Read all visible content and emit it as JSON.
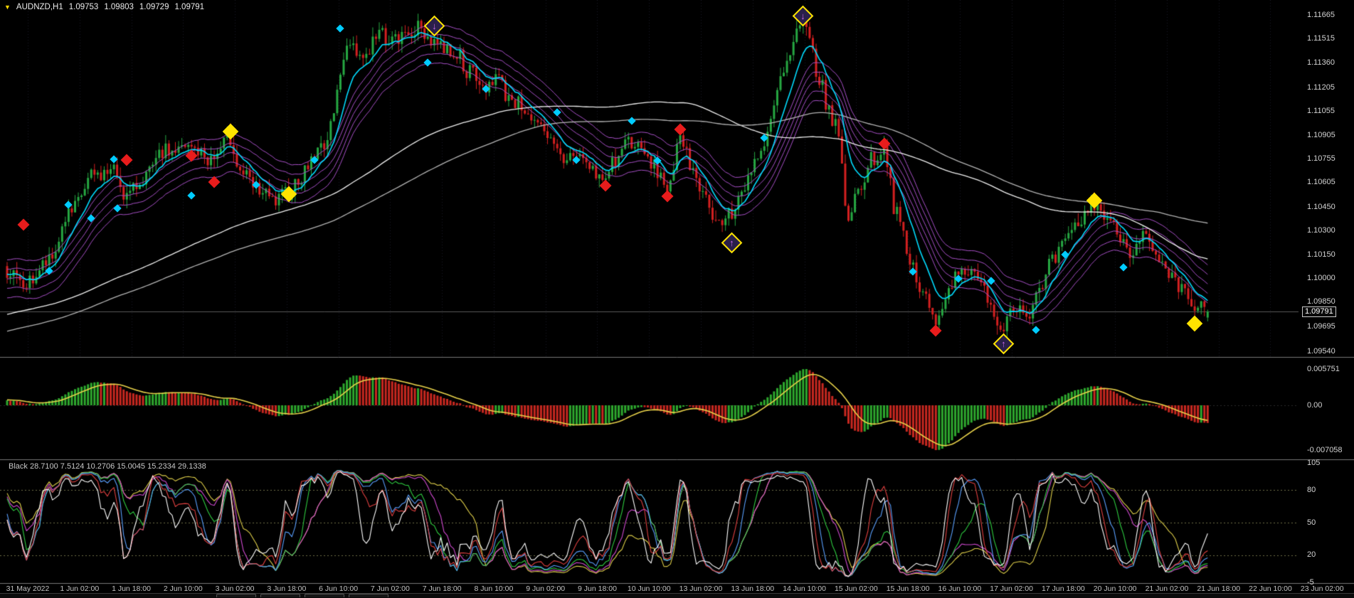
{
  "header": {
    "symbol": "AUDNZD,H1",
    "open": "1.09753",
    "high": "1.09803",
    "low": "1.09729",
    "close": "1.09791"
  },
  "icons": {
    "symbol_dropdown": "▼",
    "arrow_up": "↑",
    "arrow_down": "↓"
  },
  "colors": {
    "background": "#000000",
    "bull": "#26a842",
    "bear": "#d42020",
    "fast_ma": "#00dcff",
    "band": "#a850c8",
    "slow_ma_1": "#f0f0f0",
    "slow_ma_2": "#b4b4b4",
    "price_line": "#5a5a5a",
    "divider": "#787878",
    "grid": "#1b1b26",
    "level_dotted": "#6e6e46",
    "marker_cyan": "#00ccff",
    "marker_red": "#e81c1c",
    "marker_yellow": "#ffe400",
    "marker_arrow_fill": "#2a1f4a",
    "marker_arrow_glyph": "#c668e8"
  },
  "price_scale": {
    "current": "1.09791",
    "labels": [
      "1.11665",
      "1.11515",
      "1.11360",
      "1.11205",
      "1.11055",
      "1.10905",
      "1.10755",
      "1.10605",
      "1.10450",
      "1.10300",
      "1.10150",
      "1.10000",
      "1.09850",
      "1.09695",
      "1.09540"
    ],
    "values": [
      1.11665,
      1.11515,
      1.1136,
      1.11205,
      1.11055,
      1.10905,
      1.10755,
      1.10605,
      1.1045,
      1.103,
      1.1015,
      1.1,
      1.0985,
      1.09695,
      1.0954
    ]
  },
  "stoch_scale": {
    "labels": [
      "105",
      "80",
      "50",
      "20",
      "-5"
    ],
    "values": [
      105,
      80,
      50,
      20,
      -5
    ]
  },
  "time_axis": {
    "labels": [
      "31 May 2022",
      "1 Jun 02:00",
      "1 Jun 18:00",
      "2 Jun 10:00",
      "3 Jun 02:00",
      "3 Jun 18:00",
      "6 Jun 10:00",
      "7 Jun 02:00",
      "7 Jun 18:00",
      "8 Jun 10:00",
      "9 Jun 02:00",
      "9 Jun 18:00",
      "10 Jun 10:00",
      "13 Jun 02:00",
      "13 Jun 18:00",
      "14 Jun 10:00",
      "15 Jun 02:00",
      "15 Jun 18:00",
      "16 Jun 10:00",
      "17 Jun 02:00",
      "17 Jun 18:00",
      "20 Jun 10:00",
      "21 Jun 02:00",
      "21 Jun 18:00",
      "22 Jun 10:00",
      "23 Jun 02:00"
    ],
    "bars_per_label": 16
  },
  "indicator_label": {
    "name": "Black",
    "values": [
      "28.7100",
      "7.5124",
      "10.2706",
      "15.0045",
      "15.2334",
      "29.1338"
    ],
    "text": "Black 28.7100 7.5124 10.2706 15.0045 15.2334 29.1338"
  },
  "bottom_bar": {
    "tab_count": 4
  },
  "chart_data": [
    {
      "type": "candlestick",
      "title": "AUDNZD H1 candles with fast EMA, purple EMA band, two slow MAs and diamond signals",
      "n_bars": 372,
      "ylim": [
        1.0954,
        1.11665
      ],
      "last_bar": {
        "open": 1.09753,
        "high": 1.09803,
        "low": 1.09729,
        "close": 1.09791
      },
      "price_anchors": [
        [
          0,
          1.1005
        ],
        [
          5,
          1.0995
        ],
        [
          13,
          1.101
        ],
        [
          19,
          1.104
        ],
        [
          27,
          1.1065
        ],
        [
          33,
          1.1068
        ],
        [
          37,
          1.1052
        ],
        [
          43,
          1.1065
        ],
        [
          49,
          1.108
        ],
        [
          57,
          1.1082
        ],
        [
          63,
          1.1075
        ],
        [
          69,
          1.1088
        ],
        [
          72,
          1.1068
        ],
        [
          77,
          1.1056
        ],
        [
          83,
          1.1048
        ],
        [
          87,
          1.1055
        ],
        [
          91,
          1.1065
        ],
        [
          95,
          1.1078
        ],
        [
          99,
          1.1088
        ],
        [
          103,
          1.113
        ],
        [
          106,
          1.115
        ],
        [
          110,
          1.114
        ],
        [
          115,
          1.1155
        ],
        [
          120,
          1.115
        ],
        [
          126,
          1.1158
        ],
        [
          131,
          1.1152
        ],
        [
          135,
          1.1146
        ],
        [
          139,
          1.1142
        ],
        [
          143,
          1.113
        ],
        [
          147,
          1.112
        ],
        [
          151,
          1.1128
        ],
        [
          155,
          1.1115
        ],
        [
          160,
          1.1108
        ],
        [
          164,
          1.1095
        ],
        [
          168,
          1.1085
        ],
        [
          172,
          1.1075
        ],
        [
          176,
          1.108
        ],
        [
          180,
          1.107
        ],
        [
          184,
          1.1062
        ],
        [
          188,
          1.1075
        ],
        [
          192,
          1.1088
        ],
        [
          196,
          1.108
        ],
        [
          200,
          1.107
        ],
        [
          204,
          1.1058
        ],
        [
          208,
          1.1085
        ],
        [
          212,
          1.107
        ],
        [
          216,
          1.105
        ],
        [
          220,
          1.1035
        ],
        [
          224,
          1.104
        ],
        [
          228,
          1.106
        ],
        [
          231,
          1.1075
        ],
        [
          234,
          1.108
        ],
        [
          236,
          1.11
        ],
        [
          239,
          1.1125
        ],
        [
          242,
          1.114
        ],
        [
          244,
          1.1155
        ],
        [
          246,
          1.116
        ],
        [
          248,
          1.115
        ],
        [
          251,
          1.1125
        ],
        [
          254,
          1.1105
        ],
        [
          256,
          1.1098
        ],
        [
          260,
          1.104
        ],
        [
          263,
          1.1055
        ],
        [
          267,
          1.1075
        ],
        [
          271,
          1.1082
        ],
        [
          275,
          1.104
        ],
        [
          279,
          1.101
        ],
        [
          283,
          1.099
        ],
        [
          287,
          1.0972
        ],
        [
          291,
          1.0995
        ],
        [
          295,
          1.1008
        ],
        [
          299,
          1.1
        ],
        [
          303,
          1.099
        ],
        [
          307,
          1.0968
        ],
        [
          311,
          1.0985
        ],
        [
          315,
          1.0978
        ],
        [
          319,
          1.099
        ],
        [
          323,
          1.101
        ],
        [
          327,
          1.1022
        ],
        [
          331,
          1.1035
        ],
        [
          336,
          1.1048
        ],
        [
          339,
          1.104
        ],
        [
          343,
          1.103
        ],
        [
          347,
          1.1018
        ],
        [
          351,
          1.1028
        ],
        [
          355,
          1.1012
        ],
        [
          359,
          1.1
        ],
        [
          363,
          1.0992
        ],
        [
          367,
          1.0982
        ],
        [
          371,
          1.0979
        ]
      ],
      "overlays": [
        {
          "name": "fast-ema",
          "period": 9
        },
        {
          "name": "purple-band-ema",
          "period": 21,
          "offsets": [
            -0.0012,
            -0.0006,
            0,
            0.0006,
            0.0012
          ]
        },
        {
          "name": "slow-ma-1",
          "period": 110
        },
        {
          "name": "slow-ma-2",
          "period": 150
        }
      ]
    },
    {
      "type": "bar",
      "name": "macd-histogram-with-signal",
      "params": {
        "fast": 12,
        "slow": 26,
        "signal": 9
      },
      "ylabels": [
        "0.005751",
        "0.00",
        "-0.007058"
      ],
      "ylim": [
        -0.007058,
        0.005751
      ],
      "colors": {
        "rising": "#2ea82e",
        "falling": "#c82820",
        "signal": "#e8d24a"
      }
    },
    {
      "type": "line",
      "name": "multi-stochastic",
      "ylim": [
        -5,
        105
      ],
      "levels": [
        80,
        50,
        20
      ],
      "series": [
        {
          "name": "stoch-5",
          "period": 5,
          "color": "#ffffff",
          "last": "28.7100"
        },
        {
          "name": "stoch-9",
          "period": 9,
          "color": "#e04040",
          "last": "7.5124"
        },
        {
          "name": "stoch-14",
          "period": 14,
          "color": "#5aa0ff",
          "last": "10.2706"
        },
        {
          "name": "stoch-21",
          "period": 21,
          "color": "#2ecc40",
          "last": "15.0045"
        },
        {
          "name": "stoch-30",
          "period": 30,
          "color": "#d24ad2",
          "last": "15.2334"
        },
        {
          "name": "stoch-44",
          "period": 44,
          "color": "#e0d04a",
          "last": "29.1338"
        }
      ]
    }
  ],
  "signals": [
    {
      "t": 5,
      "price": 1.10341,
      "type": "red"
    },
    {
      "t": 13,
      "price": 1.10047,
      "type": "cyan"
    },
    {
      "t": 19,
      "price": 1.10466,
      "type": "cyan"
    },
    {
      "t": 26,
      "price": 1.1038,
      "type": "cyan"
    },
    {
      "t": 33,
      "price": 1.10755,
      "type": "cyan"
    },
    {
      "t": 34,
      "price": 1.10444,
      "type": "cyan"
    },
    {
      "t": 37,
      "price": 1.1075,
      "type": "red"
    },
    {
      "t": 57,
      "price": 1.10777,
      "type": "red"
    },
    {
      "t": 57,
      "price": 1.10526,
      "type": "cyan"
    },
    {
      "t": 64,
      "price": 1.10608,
      "type": "red"
    },
    {
      "t": 69,
      "price": 1.10929,
      "type": "yellow"
    },
    {
      "t": 77,
      "price": 1.10592,
      "type": "cyan"
    },
    {
      "t": 87,
      "price": 1.10532,
      "type": "yellow"
    },
    {
      "t": 95,
      "price": 1.1075,
      "type": "cyan"
    },
    {
      "t": 103,
      "price": 1.11578,
      "type": "cyan"
    },
    {
      "t": 130,
      "price": 1.11365,
      "type": "cyan"
    },
    {
      "t": 132,
      "price": 1.11594,
      "type": "arrow-down"
    },
    {
      "t": 148,
      "price": 1.11196,
      "type": "cyan"
    },
    {
      "t": 170,
      "price": 1.11049,
      "type": "cyan"
    },
    {
      "t": 176,
      "price": 1.1075,
      "type": "cyan"
    },
    {
      "t": 185,
      "price": 1.10586,
      "type": "red"
    },
    {
      "t": 193,
      "price": 1.10995,
      "type": "cyan"
    },
    {
      "t": 201,
      "price": 1.10744,
      "type": "cyan"
    },
    {
      "t": 204,
      "price": 1.10521,
      "type": "red"
    },
    {
      "t": 208,
      "price": 1.1094,
      "type": "red"
    },
    {
      "t": 224,
      "price": 1.10227,
      "type": "arrow-up"
    },
    {
      "t": 234,
      "price": 1.10886,
      "type": "cyan"
    },
    {
      "t": 246,
      "price": 1.1166,
      "type": "arrow-down"
    },
    {
      "t": 271,
      "price": 1.10853,
      "type": "red"
    },
    {
      "t": 280,
      "price": 1.10041,
      "type": "cyan"
    },
    {
      "t": 287,
      "price": 1.09671,
      "type": "red"
    },
    {
      "t": 294,
      "price": 1.09998,
      "type": "cyan"
    },
    {
      "t": 304,
      "price": 1.09987,
      "type": "cyan"
    },
    {
      "t": 308,
      "price": 1.09589,
      "type": "arrow-up"
    },
    {
      "t": 318,
      "price": 1.09676,
      "type": "cyan"
    },
    {
      "t": 327,
      "price": 1.1015,
      "type": "cyan"
    },
    {
      "t": 336,
      "price": 1.10494,
      "type": "yellow"
    },
    {
      "t": 345,
      "price": 1.10068,
      "type": "cyan"
    },
    {
      "t": 367,
      "price": 1.09714,
      "type": "yellow"
    }
  ]
}
